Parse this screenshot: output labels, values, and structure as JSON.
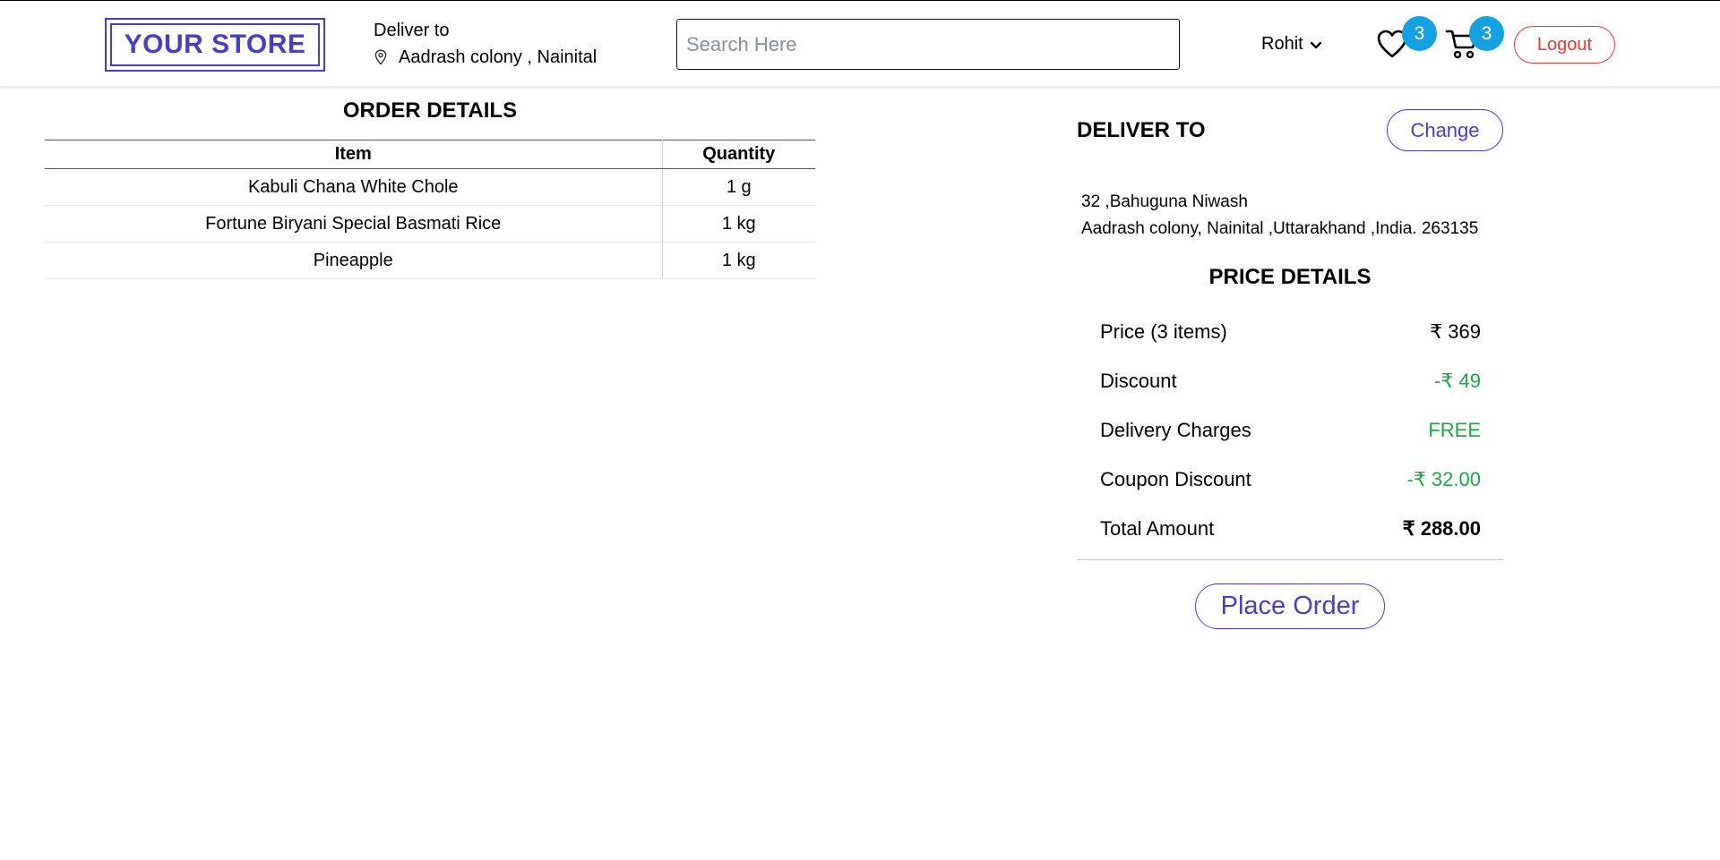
{
  "header": {
    "logo_text": "YOUR STORE",
    "deliver_label": "Deliver to",
    "deliver_location": "Aadrash colony , Nainital",
    "location_icon": "location-pin-icon",
    "search_placeholder": "Search Here",
    "search_value": "",
    "user_name": "Rohit",
    "user_chevron_icon": "chevron-down-icon",
    "wishlist_icon": "heart-icon",
    "wishlist_count": "3",
    "cart_icon": "cart-icon",
    "cart_count": "3",
    "logout_label": "Logout"
  },
  "order": {
    "title": "ORDER DETAILS",
    "columns": [
      "Item",
      "Quantity"
    ],
    "rows": [
      {
        "item": "Kabuli Chana White Chole",
        "quantity": "1 g"
      },
      {
        "item": "Fortune Biryani Special Basmati Rice",
        "quantity": "1 kg"
      },
      {
        "item": "Pineapple",
        "quantity": "1 kg"
      }
    ]
  },
  "delivery": {
    "title": "DELIVER TO",
    "change_label": "Change",
    "address_line1": "32 ,Bahuguna Niwash",
    "address_line2": "Aadrash colony, Nainital ,Uttarakhand ,India. 263135"
  },
  "price": {
    "title": "PRICE DETAILS",
    "rows": [
      {
        "label": "Price (3 items)",
        "value": "₹ 369"
      },
      {
        "label": "Discount",
        "value": "-₹ 49"
      },
      {
        "label": "Delivery Charges",
        "value": "FREE"
      },
      {
        "label": "Coupon Discount",
        "value": "-₹ 32.00"
      },
      {
        "label": "Total Amount",
        "value": "₹ 288.00"
      }
    ],
    "place_order_label": "Place Order"
  },
  "colors": {
    "brand": "#4a3fc4",
    "badge": "#15a0e0",
    "logout": "#e53935",
    "positive": "#1fa64a"
  }
}
